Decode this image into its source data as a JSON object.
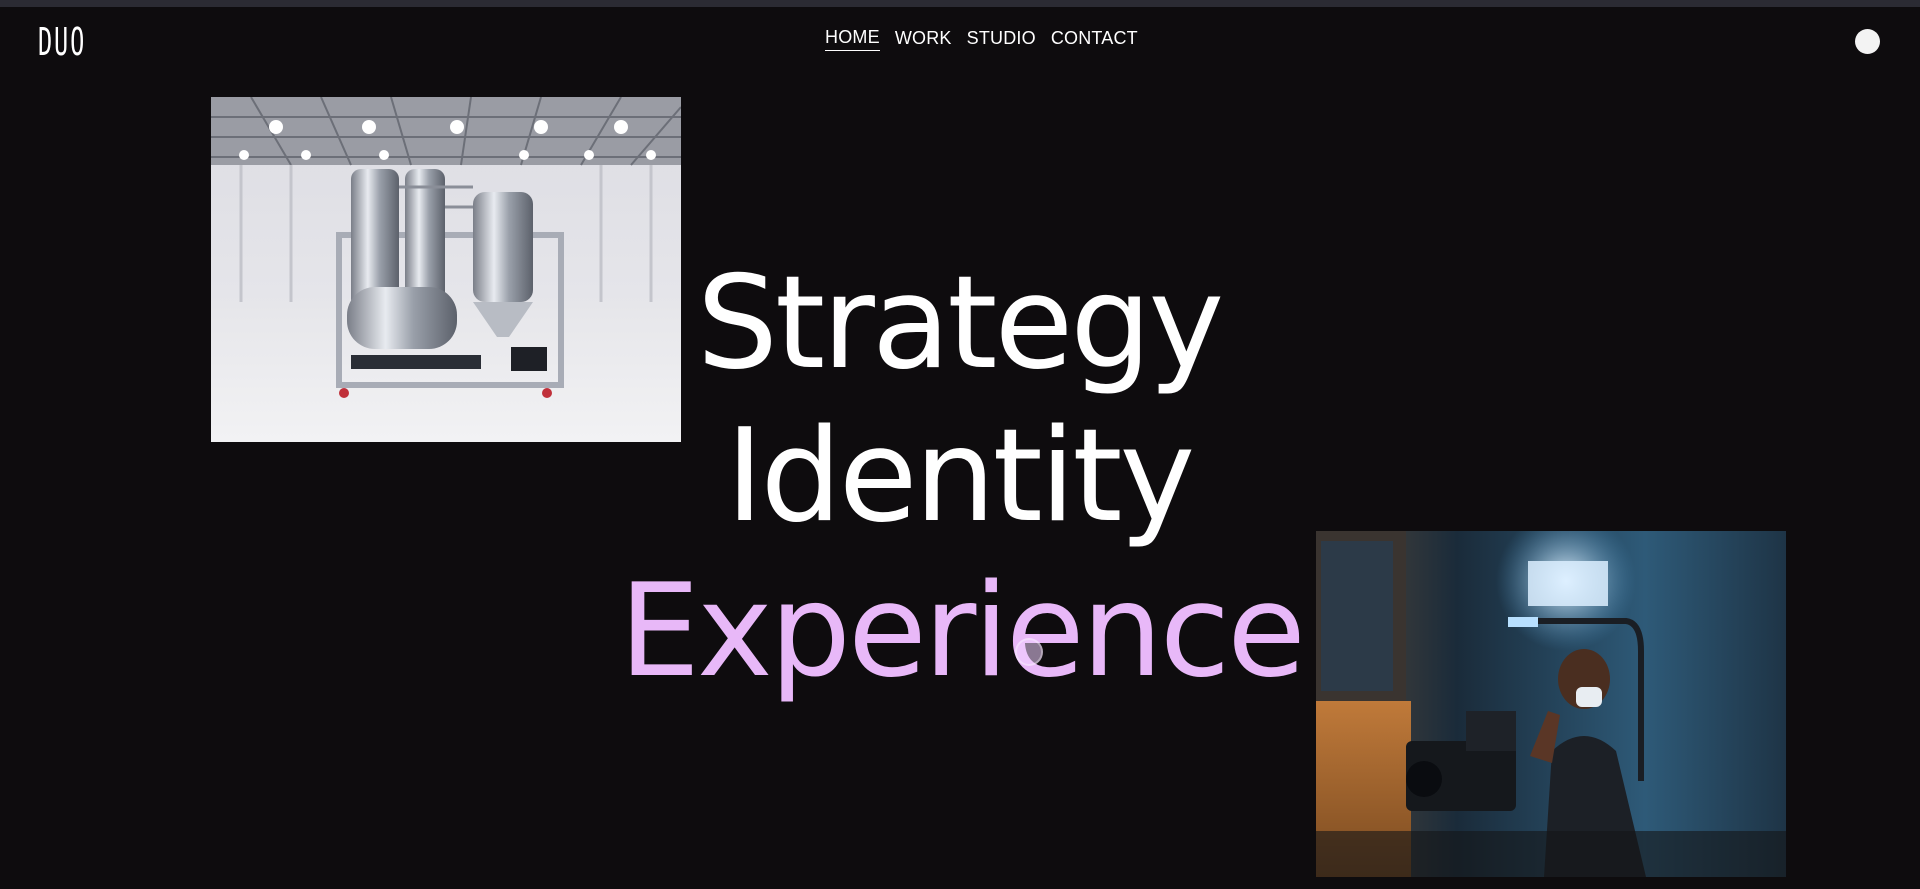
{
  "header": {
    "logo_text": "DUO",
    "nav": [
      {
        "label": "HOME",
        "active": true
      },
      {
        "label": "WORK",
        "active": false
      },
      {
        "label": "STUDIO",
        "active": false
      },
      {
        "label": "CONTACT",
        "active": false
      }
    ],
    "menu_button_icon": "circle-icon"
  },
  "hero": {
    "line1": "Strategy",
    "line2": "Identity",
    "line3": "Experience",
    "accent_color": "#e8b8f8",
    "text_color": "#ffffff",
    "background_color": "#0e0c0e"
  },
  "images": {
    "top_left_icon": "industrial-machine-photo",
    "bottom_right_icon": "camera-operator-photo"
  }
}
